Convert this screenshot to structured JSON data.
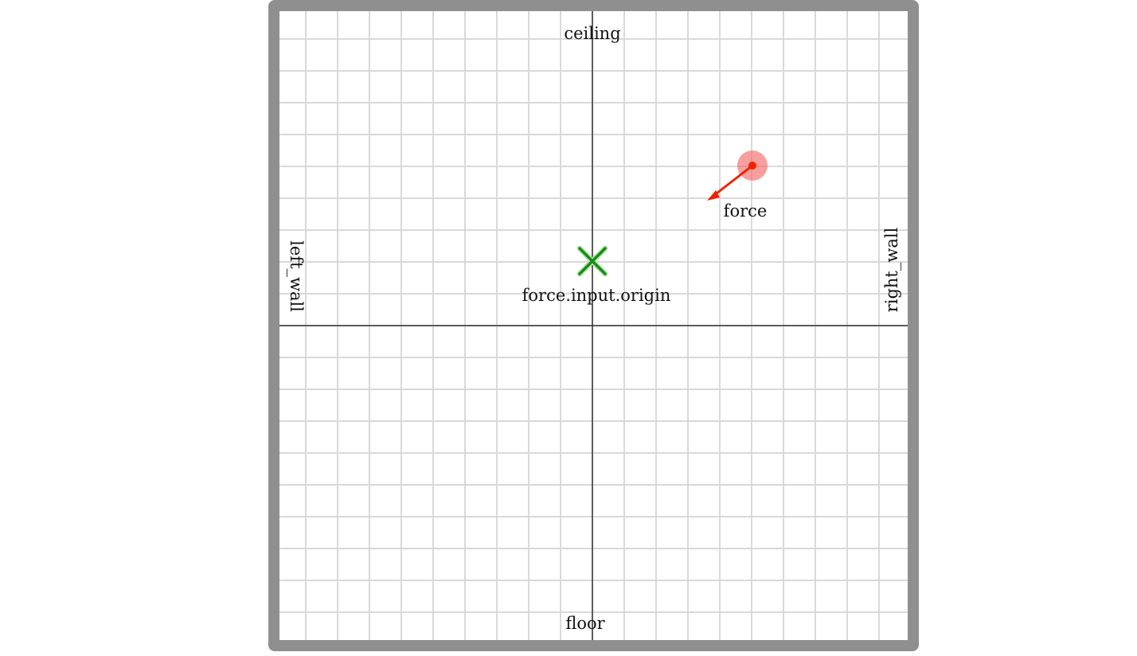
{
  "labels": {
    "ceiling": "ceiling",
    "floor": "floor",
    "left_wall": "left_wall",
    "right_wall": "right_wall",
    "force": "force",
    "origin": "force.input.origin"
  },
  "colors": {
    "frame": "#8f8f8f",
    "grid": "#d9d9d9",
    "axis": "#333333",
    "force_arrow": "#ee2200",
    "force_handle": "#f36b6b",
    "origin_marker": "#1a8c1a"
  },
  "icons": {
    "origin": "x-mark-icon",
    "force_handle": "drag-handle-icon",
    "force_arrow": "arrow-icon"
  }
}
